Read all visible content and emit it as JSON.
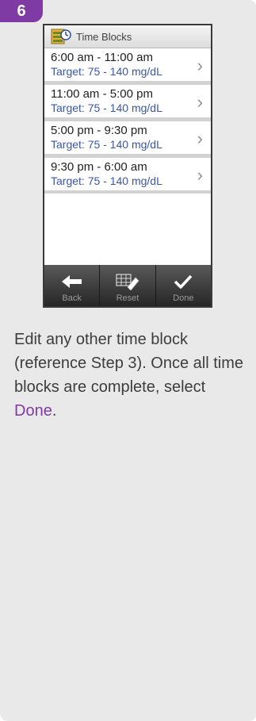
{
  "step": {
    "number": "6"
  },
  "screen": {
    "title": "Time Blocks",
    "header_icon": "time-blocks-icon",
    "time_blocks": [
      {
        "time": "6:00 am - 11:00 am",
        "target": "Target: 75 - 140 mg/dL"
      },
      {
        "time": "11:00 am - 5:00 pm",
        "target": "Target: 75 - 140 mg/dL"
      },
      {
        "time": "5:00 pm - 9:30 pm",
        "target": "Target: 75 - 140 mg/dL"
      },
      {
        "time": "9:30 pm - 6:00 am",
        "target": "Target: 75 - 140 mg/dL"
      }
    ],
    "toolbar": {
      "back_label": "Back",
      "reset_label": "Reset",
      "done_label": "Done"
    }
  },
  "instructions": {
    "text": "Edit any other time block (reference Step 3). Once all time blocks are complete, select ",
    "link": "Done",
    "end": "."
  },
  "colors": {
    "accent": "#7f3aa3",
    "target_text": "#3a56a8",
    "card_bg": "#e9e9ea"
  }
}
